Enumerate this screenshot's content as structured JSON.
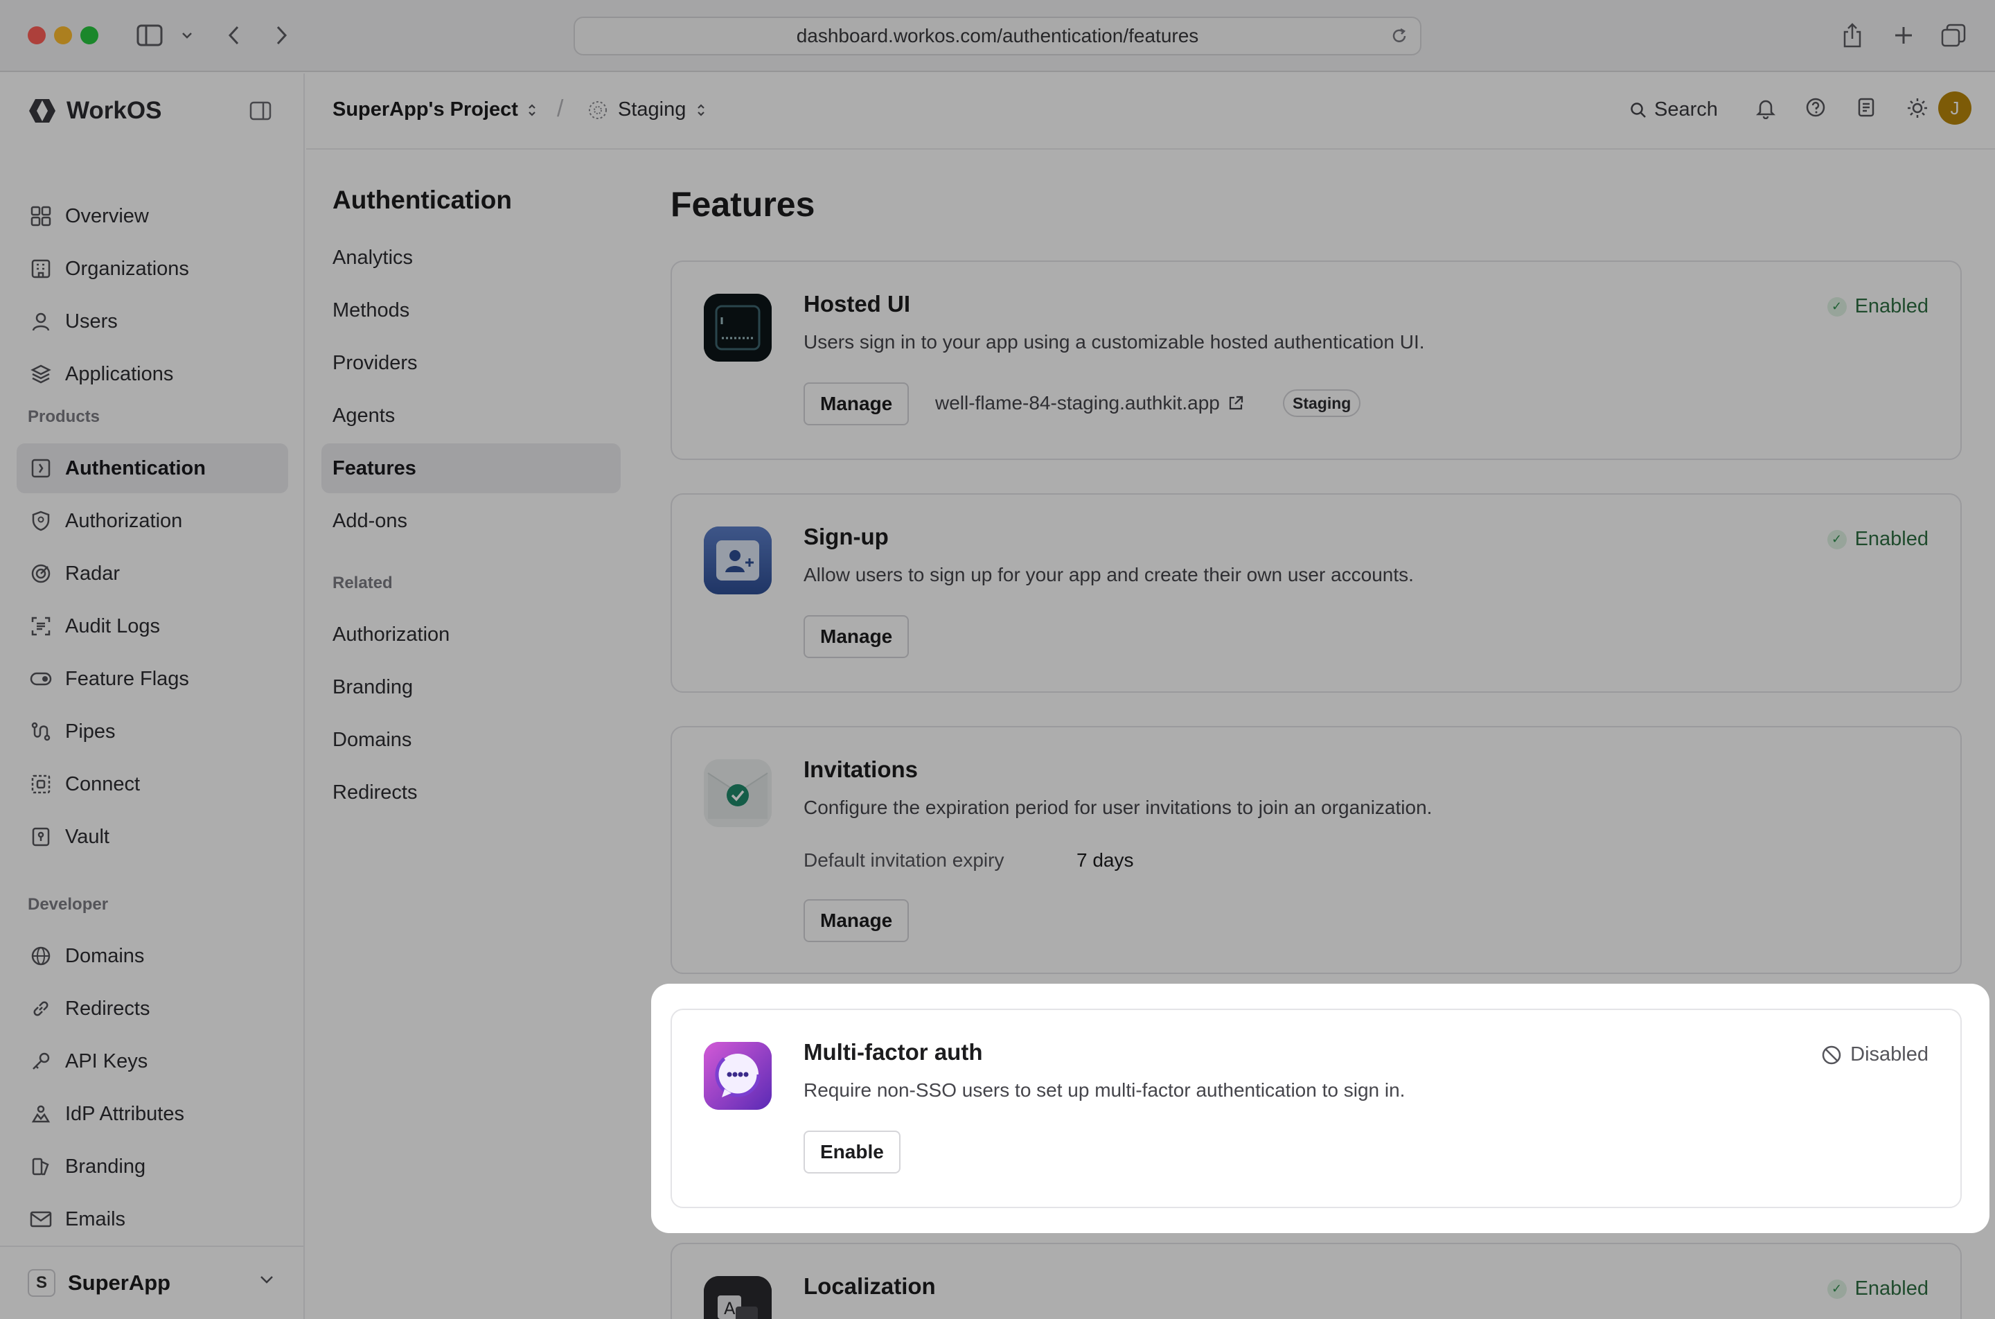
{
  "browser": {
    "url": "dashboard.workos.com/authentication/features"
  },
  "sidebar": {
    "brand": "WorkOS",
    "items_top": [
      {
        "label": "Overview",
        "icon": "grid-icon"
      },
      {
        "label": "Organizations",
        "icon": "building-icon"
      },
      {
        "label": "Users",
        "icon": "user-icon"
      },
      {
        "label": "Applications",
        "icon": "layers-icon"
      }
    ],
    "products_label": "Products",
    "products": [
      {
        "label": "Authentication",
        "icon": "auth-icon",
        "active": true
      },
      {
        "label": "Authorization",
        "icon": "shield-icon"
      },
      {
        "label": "Radar",
        "icon": "radar-icon"
      },
      {
        "label": "Audit Logs",
        "icon": "audit-icon"
      },
      {
        "label": "Feature Flags",
        "icon": "toggle-icon"
      },
      {
        "label": "Pipes",
        "icon": "pipes-icon"
      },
      {
        "label": "Connect",
        "icon": "connect-icon"
      },
      {
        "label": "Vault",
        "icon": "vault-icon"
      }
    ],
    "developer_label": "Developer",
    "developer": [
      {
        "label": "Domains",
        "icon": "globe-icon"
      },
      {
        "label": "Redirects",
        "icon": "link-icon"
      },
      {
        "label": "API Keys",
        "icon": "key-icon"
      },
      {
        "label": "IdP Attributes",
        "icon": "attributes-icon"
      },
      {
        "label": "Branding",
        "icon": "branding-icon"
      },
      {
        "label": "Emails",
        "icon": "mail-icon"
      }
    ],
    "workspace": {
      "badge": "S",
      "name": "SuperApp"
    }
  },
  "header": {
    "project": "SuperApp's Project",
    "separator": "/",
    "environment": "Staging",
    "search": "Search",
    "avatar_initial": "J"
  },
  "subnav": {
    "title": "Authentication",
    "items": [
      {
        "label": "Analytics"
      },
      {
        "label": "Methods"
      },
      {
        "label": "Providers"
      },
      {
        "label": "Agents"
      },
      {
        "label": "Features",
        "active": true
      },
      {
        "label": "Add-ons"
      }
    ],
    "related_label": "Related",
    "related": [
      {
        "label": "Authorization"
      },
      {
        "label": "Branding"
      },
      {
        "label": "Domains"
      },
      {
        "label": "Redirects"
      }
    ]
  },
  "main": {
    "title": "Features",
    "cards": [
      {
        "title": "Hosted UI",
        "description": "Users sign in to your app using a customizable hosted authentication UI.",
        "status": "Enabled",
        "button": "Manage",
        "domain": "well-flame-84-staging.authkit.app",
        "badge": "Staging"
      },
      {
        "title": "Sign-up",
        "description": "Allow users to sign up for your app and create their own user accounts.",
        "status": "Enabled",
        "button": "Manage"
      },
      {
        "title": "Invitations",
        "description": "Configure the expiration period for user invitations to join an organization.",
        "kv_label": "Default invitation expiry",
        "kv_value": "7 days",
        "button": "Manage"
      },
      {
        "title": "Multi-factor auth",
        "description": "Require non-SSO users to set up multi-factor authentication to sign in.",
        "status": "Disabled",
        "button": "Enable"
      },
      {
        "title": "Localization",
        "status": "Enabled"
      }
    ]
  },
  "colors": {
    "enabled": "#2f6f43",
    "active_nav": "#ececef",
    "overlay": "rgba(0,0,0,0.32)"
  }
}
